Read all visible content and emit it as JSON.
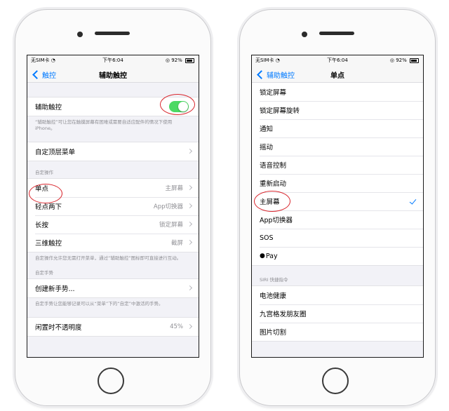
{
  "status_bar": {
    "carrier": "无SIM卡",
    "wifi_icon": "wifi-icon",
    "time": "下午6:04",
    "battery": "92%"
  },
  "left_screen": {
    "nav": {
      "back_label": "触控",
      "title": "辅助触控"
    },
    "assistive_touch": {
      "label": "辅助触控",
      "toggle_on": true,
      "footer": "“辅助触控”可让您在触摸屏幕有困难或需要自适应配件的情况下使用iPhone。"
    },
    "customize_menu": {
      "label": "自定顶层菜单"
    },
    "custom_actions": {
      "header": "自定操作",
      "rows": [
        {
          "label": "单点",
          "value": "主屏幕"
        },
        {
          "label": "轻点两下",
          "value": "App切换器"
        },
        {
          "label": "长按",
          "value": "锁定屏幕"
        },
        {
          "label": "三维触控",
          "value": "截屏"
        }
      ],
      "footer": "自定操作允许您无需打开菜单，通过“辅助触控”图标即可直接进行互动。"
    },
    "custom_gestures": {
      "header": "自定手势",
      "create_label": "创建新手势...",
      "footer": "自定手势让您能够记录可以从“菜单”下的“自定”中激活的手势。"
    },
    "idle_opacity": {
      "label": "闲置时不透明度",
      "value": "45%"
    }
  },
  "right_screen": {
    "nav": {
      "back_label": "辅助触控",
      "title": "单点"
    },
    "options": [
      {
        "label": "锁定屏幕"
      },
      {
        "label": "锁定屏幕旋转"
      },
      {
        "label": "通知"
      },
      {
        "label": "摇动"
      },
      {
        "label": "语音控制"
      },
      {
        "label": "重新启动"
      },
      {
        "label": "主屏幕",
        "selected": true
      },
      {
        "label": "App切换器"
      },
      {
        "label": "SOS"
      },
      {
        "label": "Pay",
        "apple_logo": true
      }
    ],
    "siri": {
      "header": "SIRI 快捷指令",
      "items": [
        {
          "label": "电池健康"
        },
        {
          "label": "九宫格发朋友圈"
        },
        {
          "label": "图片切割"
        }
      ]
    }
  },
  "colors": {
    "toggle_on": "#4cd964",
    "accent": "#007aff",
    "annotation_circle": "#d9272e"
  }
}
